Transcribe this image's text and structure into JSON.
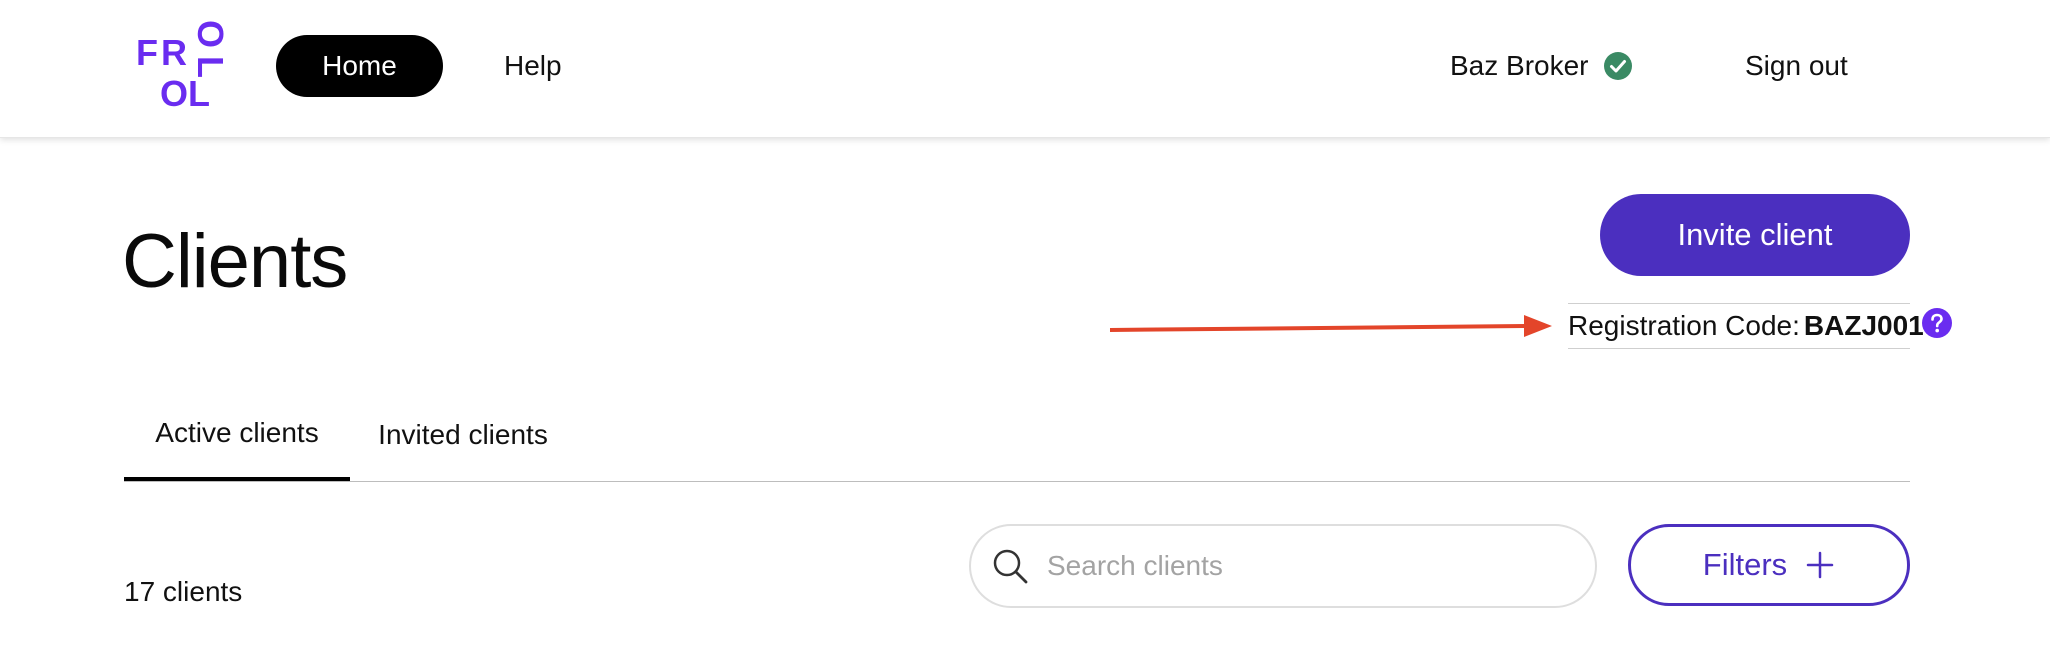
{
  "colors": {
    "brand": "#6a2cf0",
    "primary": "#4b2fbf",
    "verified": "#3a8a64",
    "arrow": "#e3452a"
  },
  "header": {
    "logo_letters": [
      "F",
      "R",
      "O",
      "L",
      "O",
      "L"
    ],
    "nav": {
      "home": "Home",
      "help": "Help"
    },
    "user_name": "Baz Broker",
    "verified_icon": "check-circle-icon",
    "sign_out": "Sign out"
  },
  "main": {
    "title": "Clients",
    "invite_label": "Invite client",
    "registration": {
      "label": "Registration Code:",
      "code": "BAZJ001"
    },
    "help_icon": "question-circle-icon",
    "tabs": [
      {
        "label": "Active clients",
        "active": true
      },
      {
        "label": "Invited clients",
        "active": false
      }
    ],
    "client_count": "17 clients",
    "search": {
      "placeholder": "Search clients",
      "value": ""
    },
    "filters_label": "Filters"
  }
}
